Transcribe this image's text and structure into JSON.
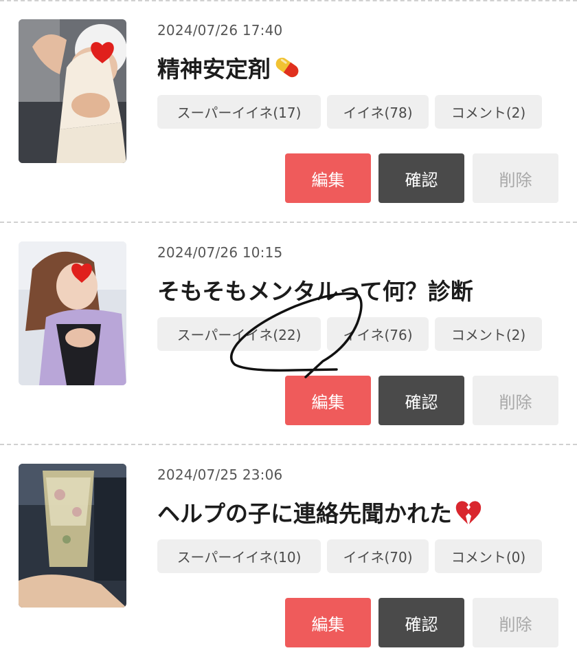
{
  "posts": [
    {
      "date": "2024/07/26 17:40",
      "title": "精神安定剤",
      "title_emoji": "pill-icon",
      "super_like": "スーパーイイネ(17)",
      "like": "イイネ(78)",
      "comment": "コメント(2)",
      "edit_label": "編集",
      "confirm_label": "確認",
      "delete_label": "削除"
    },
    {
      "date": "2024/07/26 10:15",
      "title": "そもそもメンタルって何？診断",
      "title_emoji": "",
      "super_like": "スーパーイイネ(22)",
      "like": "イイネ(76)",
      "comment": "コメント(2)",
      "edit_label": "編集",
      "confirm_label": "確認",
      "delete_label": "削除"
    },
    {
      "date": "2024/07/25 23:06",
      "title": "ヘルプの子に連絡先聞かれた",
      "title_emoji": "broken-heart-icon",
      "super_like": "スーパーイイネ(10)",
      "like": "イイネ(70)",
      "comment": "コメント(0)",
      "edit_label": "編集",
      "confirm_label": "確認",
      "delete_label": "削除"
    }
  ],
  "colors": {
    "edit": "#ef5b5b",
    "confirm": "#4a4a4a",
    "delete_bg": "#efefef",
    "tag_bg": "#efefef",
    "divider": "#d0d0d0"
  }
}
